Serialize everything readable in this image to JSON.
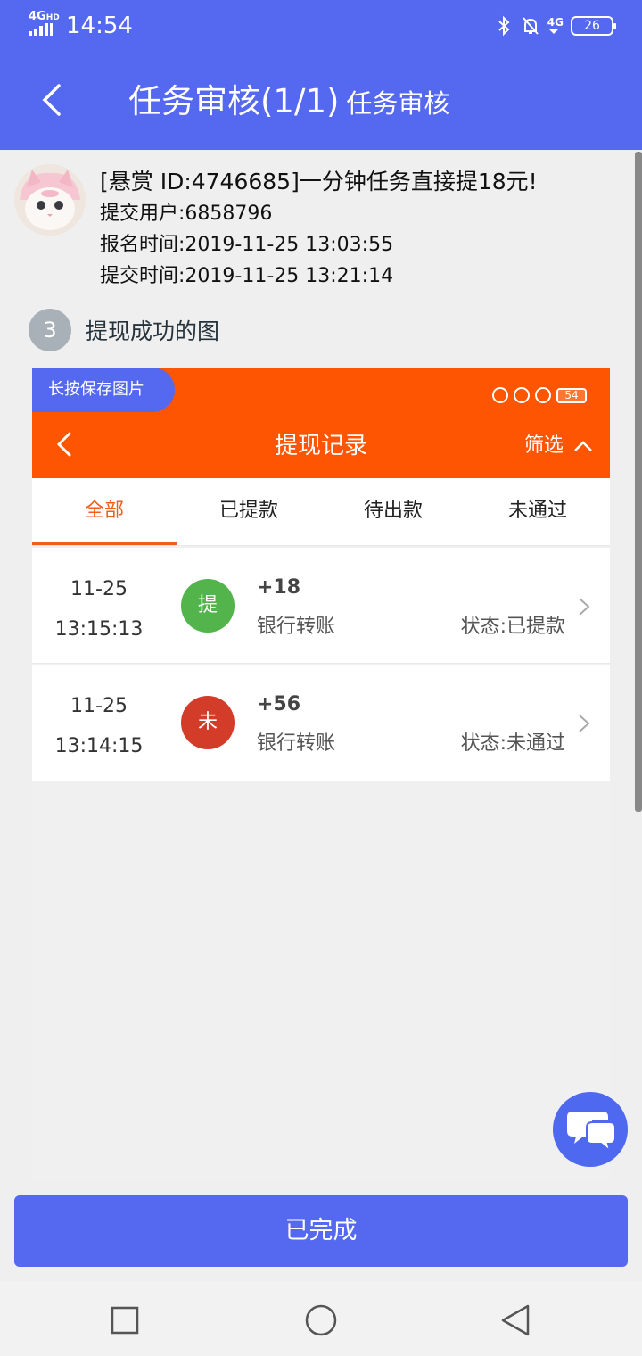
{
  "status_bar": {
    "network": "4G",
    "network_sup": "HD",
    "time": "14:54",
    "net_type": "4G",
    "battery": "26"
  },
  "header": {
    "title": "任务审核(1/1)",
    "subtitle": "任务审核"
  },
  "task": {
    "title": "[悬赏 ID:4746685]一分钟任务直接提18元!",
    "submit_user": "提交用户:6858796",
    "signup_time": "报名时间:2019-11-25 13:03:55",
    "submit_time": "提交时间:2019-11-25 13:21:14"
  },
  "step": {
    "number": "3",
    "label": "提现成功的图"
  },
  "screenshot": {
    "save_hint": "长按保存图片",
    "battery": "54",
    "title": "提现记录",
    "filter": "筛选",
    "tabs": [
      "全部",
      "已提款",
      "待出款",
      "未通过"
    ],
    "records": [
      {
        "date": "11-25",
        "time": "13:15:13",
        "badge": "提",
        "badge_color": "#52b44b",
        "amount": "+18",
        "method": "银行转账",
        "status": "状态:已提款"
      },
      {
        "date": "11-25",
        "time": "13:14:15",
        "badge": "未",
        "badge_color": "#d43c2a",
        "amount": "+56",
        "method": "银行转账",
        "status": "状态:未通过"
      }
    ]
  },
  "done_button": "已完成",
  "colors": {
    "primary": "#5468f0",
    "orange": "#fd5502",
    "active_tab": "#f15d1d"
  }
}
